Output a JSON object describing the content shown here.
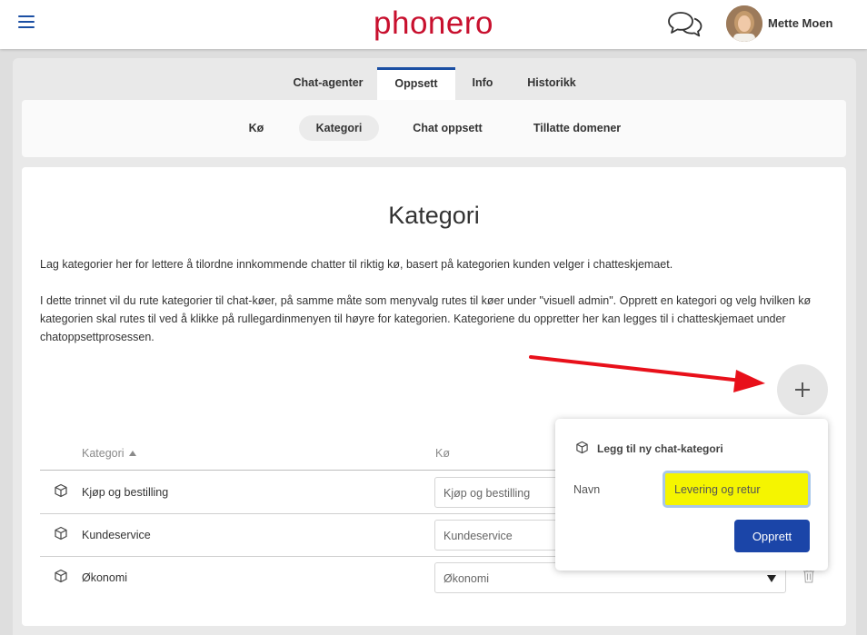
{
  "header": {
    "logo_text": "phonero",
    "user_name": "Mette Moen"
  },
  "tabs": [
    {
      "label": "Chat-agenter",
      "active": false
    },
    {
      "label": "Oppsett",
      "active": true
    },
    {
      "label": "Info",
      "active": false
    },
    {
      "label": "Historikk",
      "active": false
    }
  ],
  "subtabs": [
    {
      "label": "Kø",
      "active": false
    },
    {
      "label": "Kategori",
      "active": true
    },
    {
      "label": "Chat oppsett",
      "active": false
    },
    {
      "label": "Tillatte domener",
      "active": false
    }
  ],
  "page": {
    "title": "Kategori",
    "description_1": "Lag kategorier her for lettere å tilordne innkommende chatter til riktig kø, basert på kategorien kunden velger i chatteskjemaet.",
    "description_2": "I dette trinnet vil du rute kategorier til chat-køer, på samme måte som menyvalg rutes til køer under \"visuell admin\". Opprett en kategori og velg hvilken kø kategorien skal rutes til ved å klikke på rullegardinmenyen til høyre for kategorien. Kategoriene du oppretter her kan legges til i chatteskjemaet under chatoppsettprosessen."
  },
  "table": {
    "columns": [
      "Kategori",
      "Kø"
    ],
    "rows": [
      {
        "name": "Kjøp og bestilling",
        "queue": "Kjøp og bestilling"
      },
      {
        "name": "Kundeservice",
        "queue": "Kundeservice"
      },
      {
        "name": "Økonomi",
        "queue": "Økonomi"
      }
    ]
  },
  "popover": {
    "title": "Legg til ny chat-kategori",
    "name_label": "Navn",
    "name_value": "Levering og retur",
    "submit_label": "Opprett"
  },
  "colors": {
    "brand_red": "#c8102e",
    "accent_blue": "#1b4fa3",
    "button_blue": "#1b45a8",
    "highlight_yellow": "#f5f500",
    "annotation_arrow": "#e8101a"
  },
  "icons": {
    "menu": "hamburger-icon",
    "chat": "chat-bubbles-icon",
    "category": "cube-icon",
    "add": "plus-icon",
    "delete": "trash-icon",
    "sort": "sort-ascending-icon",
    "dropdown": "caret-down-icon"
  }
}
